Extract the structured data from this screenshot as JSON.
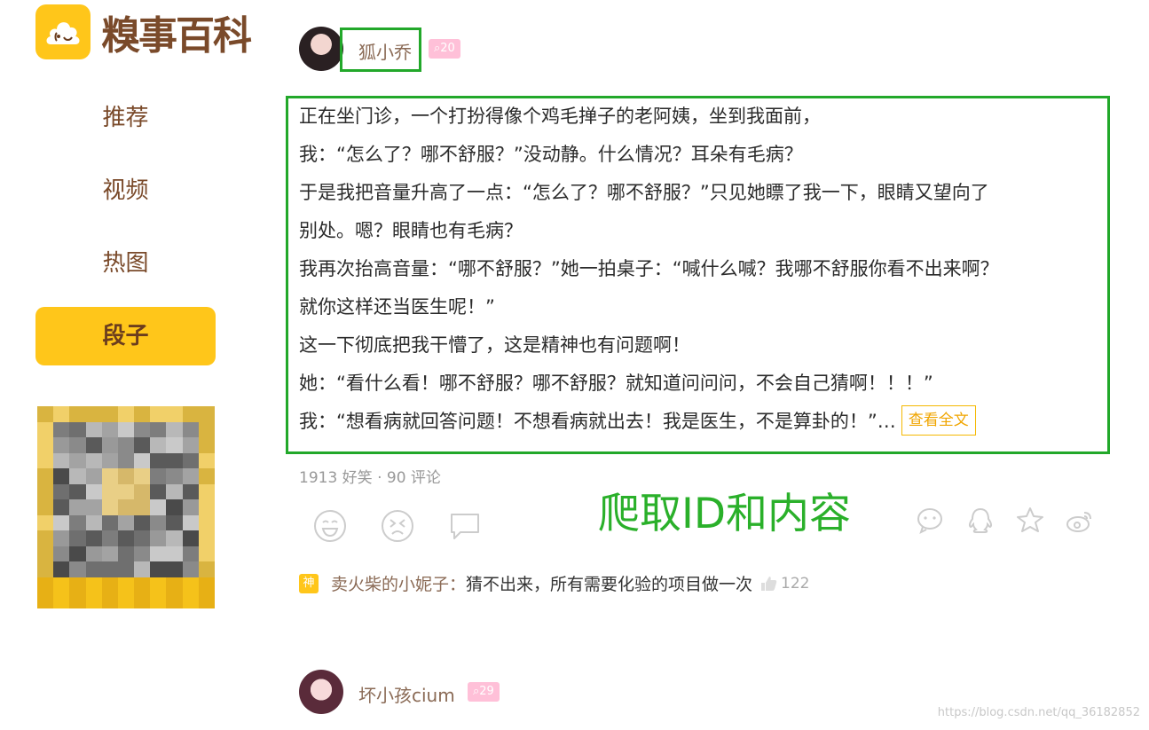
{
  "logo": {
    "text": "糗事百科",
    "icon": "laughing-poop-icon"
  },
  "nav": {
    "items": [
      {
        "label": "推荐",
        "active": false
      },
      {
        "label": "视频",
        "active": false
      },
      {
        "label": "热图",
        "active": false
      },
      {
        "label": "段子",
        "active": true
      }
    ]
  },
  "post": {
    "username": "狐小乔",
    "level": "20",
    "lines": [
      "正在坐门诊，一个打扮得像个鸡毛掸子的老阿姨，坐到我面前，",
      "我：“怎么了？哪不舒服？”没动静。什么情况？耳朵有毛病？",
      "于是我把音量升高了一点：“怎么了？哪不舒服？”只见她瞟了我一下，眼睛又望向了",
      "别处。嗯？眼睛也有毛病？",
      "我再次抬高音量：“哪不舒服？”她一拍桌子：“喊什么喊？我哪不舒服你看不出来啊？",
      "就你这样还当医生呢！”",
      "这一下彻底把我干懵了，这是精神也有问题啊！",
      "她：“看什么看！哪不舒服？哪不舒服？就知道问问问，不会自己猜啊！！！”",
      "我：“想看病就回答问题！不想看病就出去！我是医生，不是算卦的！”…"
    ],
    "more_label": "查看全文",
    "stats": "1913 好笑 · 90 评论",
    "annotation": "爬取ID和内容",
    "actions_left": [
      "smile-icon",
      "cry-icon",
      "comment-icon"
    ],
    "actions_right": [
      "wechat-icon",
      "qq-icon",
      "qzone-star-icon",
      "weibo-icon"
    ],
    "top_comment": {
      "badge": "神",
      "user": "卖火柴的小妮子：",
      "text": "猜不出来，所有需要化验的项目做一次",
      "likes": "122"
    }
  },
  "next_post": {
    "username": "坏小孩cium",
    "level": "29"
  },
  "watermark": "https://blog.csdn.net/qq_36182852",
  "colors": {
    "brand": "#FFC61A",
    "annotation": "#22a82a",
    "badge": "#ffc0d8"
  }
}
